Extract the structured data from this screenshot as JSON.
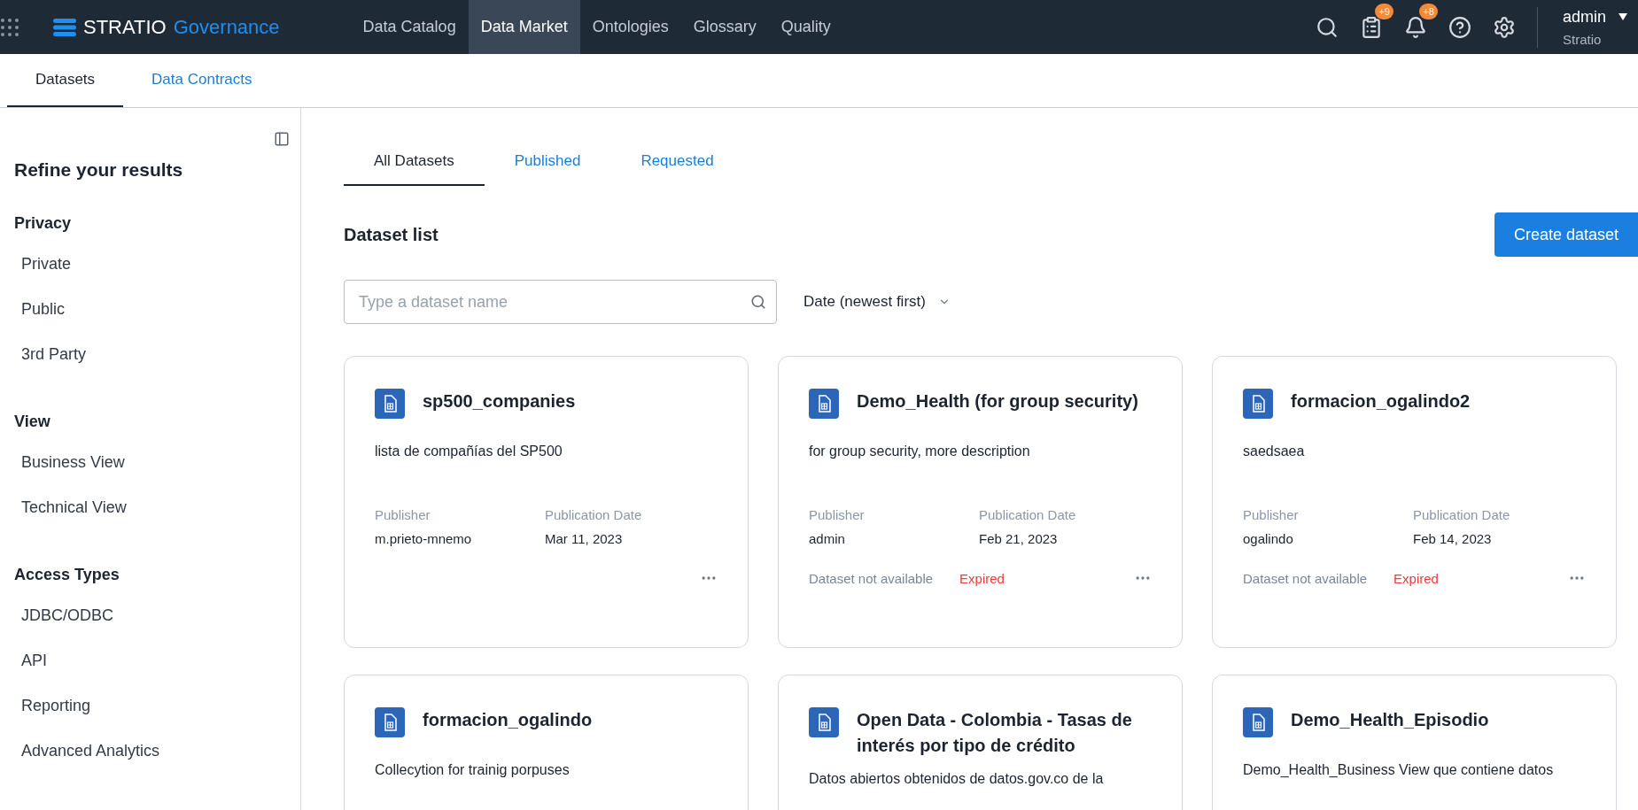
{
  "topbar": {
    "brand": "STRATIO",
    "product": "Governance",
    "nav": [
      {
        "label": "Data Catalog",
        "selected": false
      },
      {
        "label": "Data Market",
        "selected": true
      },
      {
        "label": "Ontologies",
        "selected": false
      },
      {
        "label": "Glossary",
        "selected": false
      },
      {
        "label": "Quality",
        "selected": false
      }
    ],
    "cart_badge": "+9",
    "bell_badge": "+8",
    "user": {
      "name": "admin",
      "org": "Stratio"
    }
  },
  "subtabs": [
    {
      "label": "Datasets",
      "selected": true
    },
    {
      "label": "Data Contracts",
      "selected": false
    }
  ],
  "sidebar": {
    "title": "Refine your results",
    "groups": [
      {
        "heading": "Privacy",
        "items": [
          "Private",
          "Public",
          "3rd Party"
        ]
      },
      {
        "heading": "View",
        "items": [
          "Business View",
          "Technical View"
        ]
      },
      {
        "heading": "Access Types",
        "items": [
          "JDBC/ODBC",
          "API",
          "Reporting",
          "Advanced Analytics"
        ]
      }
    ]
  },
  "tabs": [
    {
      "label": "All Datasets",
      "selected": true
    },
    {
      "label": "Published",
      "selected": false
    },
    {
      "label": "Requested",
      "selected": false
    }
  ],
  "heading": "Dataset list",
  "create_button": "Create dataset",
  "search": {
    "placeholder": "Type a dataset name"
  },
  "sort": "Date (newest first)",
  "cards": [
    {
      "title": "sp500_companies",
      "description": "lista de compañías del SP500",
      "publisher_label": "Publisher",
      "publisher": "m.prieto-mnemo",
      "date_label": "Publication Date",
      "date": "Mar 11, 2023"
    },
    {
      "title": "Demo_Health (for group security)",
      "description": "for group security, more description",
      "publisher_label": "Publisher",
      "publisher": "admin",
      "date_label": "Publication Date",
      "date": "Feb 21, 2023",
      "availability": "Dataset not available",
      "status": "Expired"
    },
    {
      "title": "formacion_ogalindo2",
      "description": "saedsaea",
      "publisher_label": "Publisher",
      "publisher": "ogalindo",
      "date_label": "Publication Date",
      "date": "Feb 14, 2023",
      "availability": "Dataset not available",
      "status": "Expired"
    },
    {
      "title": "formacion_ogalindo",
      "description": "Collecytion for trainig porpuses"
    },
    {
      "title": "Open Data - Colombia - Tasas de interés por tipo de crédito",
      "description": "Datos abiertos obtenidos de datos.gov.co de la"
    },
    {
      "title": "Demo_Health_Episodio",
      "description": "Demo_Health_Business View que contiene datos"
    }
  ]
}
